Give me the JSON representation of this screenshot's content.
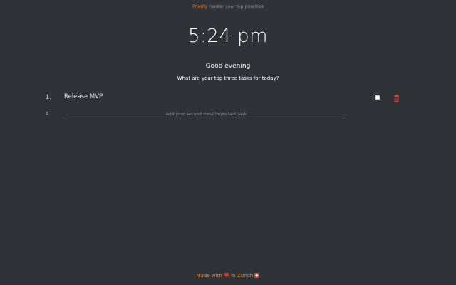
{
  "header": {
    "brand": "Priority",
    "tagline": "master your top priorities"
  },
  "clock": {
    "time": "5:24 pm"
  },
  "greeting": "Good evening",
  "prompt": "What are your top three tasks for today?",
  "tasks": [
    {
      "number": "1.",
      "title": "Release MVP",
      "completed": false,
      "icons": [
        "checkbox",
        "trash-icon"
      ]
    },
    {
      "number": "2.",
      "value": "",
      "placeholder": "Add your second most important task"
    }
  ],
  "footer": {
    "made_with": "Made with",
    "in_city": "in Zurich",
    "icons": [
      "heart-icon",
      "swiss-flag-icon"
    ]
  },
  "colors": {
    "background": "#2f3237",
    "accent": "#e8893a",
    "delete": "#d9412c"
  }
}
